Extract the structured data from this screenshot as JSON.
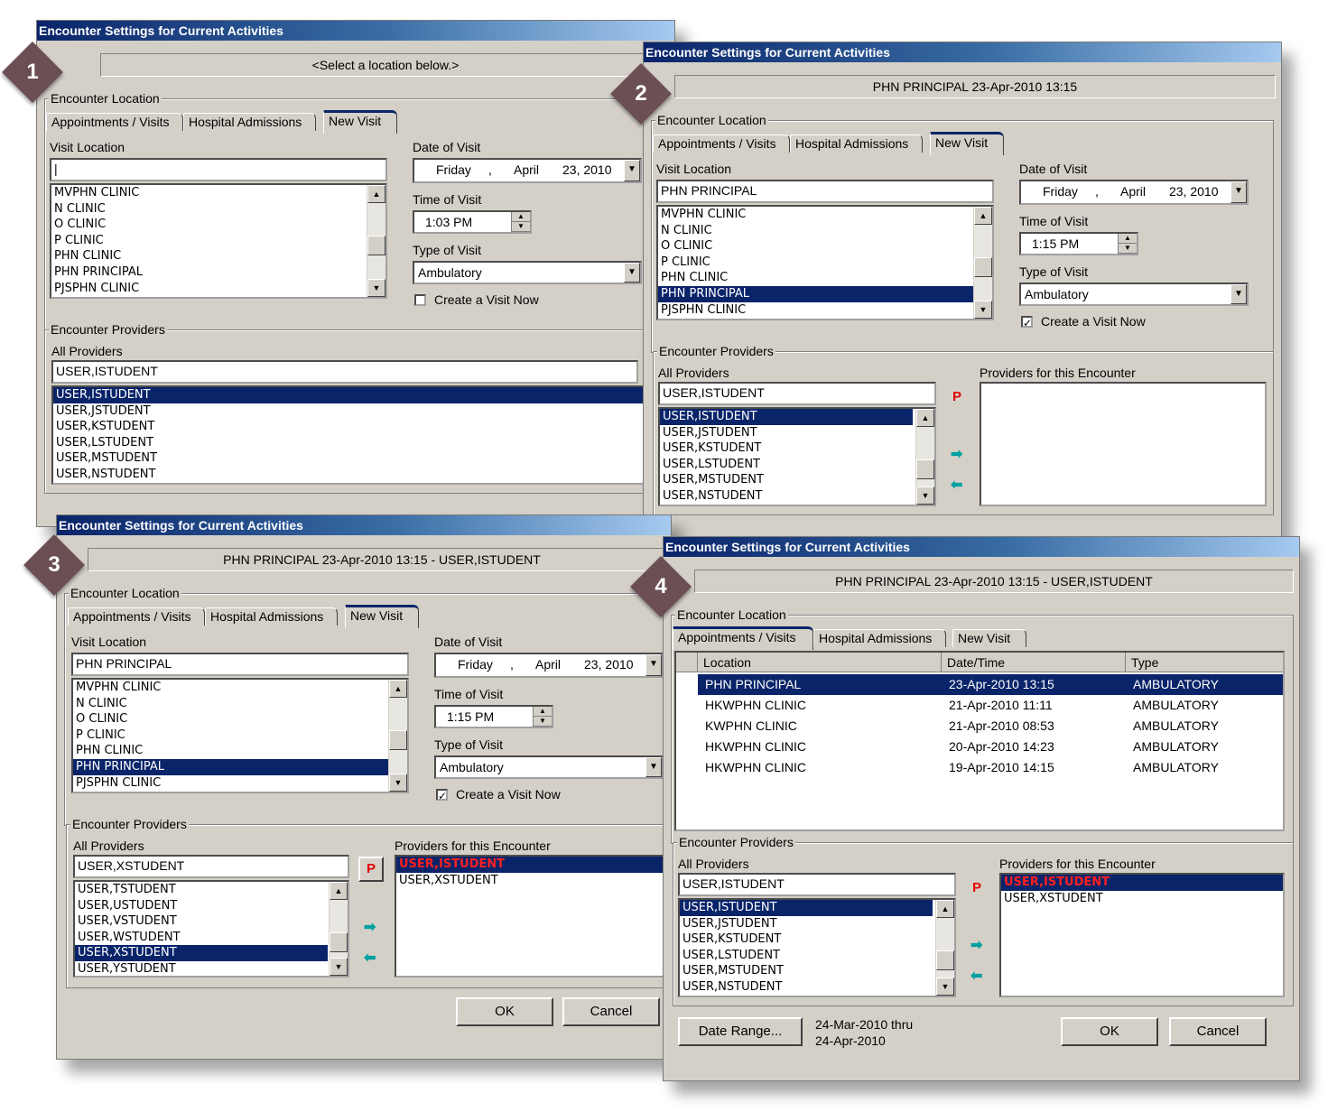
{
  "dialog_title": "Encounter Settings for Current Activities",
  "badges": [
    "1",
    "2",
    "3",
    "4"
  ],
  "labels": {
    "encounter_location": "Encounter Location",
    "visit_location": "Visit Location",
    "date_of_visit": "Date of Visit",
    "time_of_visit": "Time of Visit",
    "type_of_visit": "Type of Visit",
    "create_visit_now": "Create a Visit Now",
    "encounter_providers": "Encounter Providers",
    "all_providers": "All Providers",
    "providers_for_encounter": "Providers for this Encounter",
    "primary_marker": "P"
  },
  "tabs": [
    "Appointments / Visits",
    "Hospital Admissions",
    "New Visit"
  ],
  "date": {
    "day": "Friday",
    "sep": ",",
    "month": "April",
    "daynum": "23, 2010"
  },
  "type_of_visit_value": "Ambulatory",
  "locations": [
    "MVPHN CLINIC",
    "N CLINIC",
    "O CLINIC",
    "P CLINIC",
    "PHN CLINIC",
    "PHN PRINCIPAL",
    "PJSPHN CLINIC"
  ],
  "providers_a": [
    "USER,ISTUDENT",
    "USER,JSTUDENT",
    "USER,KSTUDENT",
    "USER,LSTUDENT",
    "USER,MSTUDENT",
    "USER,NSTUDENT"
  ],
  "providers_b": [
    "USER,TSTUDENT",
    "USER,USTUDENT",
    "USER,VSTUDENT",
    "USER,WSTUDENT",
    "USER,XSTUDENT",
    "USER,YSTUDENT"
  ],
  "w1": {
    "banner": "<Select a location below.>",
    "visit_location_value": "",
    "time": "1:03 PM",
    "provider_search": "USER,ISTUDENT"
  },
  "w2": {
    "banner": "PHN PRINCIPAL  23-Apr-2010 13:15",
    "visit_location_value": "PHN PRINCIPAL",
    "time": "1:15 PM",
    "provider_search": "USER,ISTUDENT",
    "create_checked": "✓"
  },
  "w3": {
    "banner": "PHN PRINCIPAL  23-Apr-2010 13:15  -  USER,ISTUDENT",
    "visit_location_value": "PHN PRINCIPAL",
    "time": "1:15 PM",
    "provider_search": "USER,XSTUDENT",
    "create_checked": "✓",
    "encounter_providers": [
      "USER,ISTUDENT",
      "USER,XSTUDENT"
    ],
    "ok": "OK",
    "cancel": "Cancel"
  },
  "w4": {
    "banner": "PHN PRINCIPAL  23-Apr-2010 13:15  -  USER,ISTUDENT",
    "columns": [
      "Location",
      "Date/Time",
      "Type"
    ],
    "rows": [
      [
        "PHN PRINCIPAL",
        "23-Apr-2010 13:15",
        "AMBULATORY"
      ],
      [
        "HKWPHN CLINIC",
        "21-Apr-2010 11:11",
        "AMBULATORY"
      ],
      [
        "KWPHN CLINIC",
        "21-Apr-2010 08:53",
        "AMBULATORY"
      ],
      [
        "HKWPHN CLINIC",
        "20-Apr-2010 14:23",
        "AMBULATORY"
      ],
      [
        "HKWPHN CLINIC",
        "19-Apr-2010 14:15",
        "AMBULATORY"
      ]
    ],
    "provider_search": "USER,ISTUDENT",
    "encounter_providers": [
      "USER,ISTUDENT",
      "USER,XSTUDENT"
    ],
    "date_range_button": "Date Range...",
    "date_range_line1": "24-Mar-2010 thru",
    "date_range_line2": "24-Apr-2010",
    "ok": "OK",
    "cancel": "Cancel"
  }
}
